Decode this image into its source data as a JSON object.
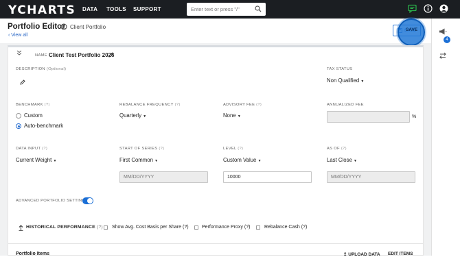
{
  "topbar": {
    "logo": "YCHARTS",
    "nav": [
      "DATA",
      "TOOLS",
      "SUPPORT"
    ],
    "search_placeholder": "Enter text or press \"/\""
  },
  "header": {
    "title": "Portfolio Editor",
    "subtitle": "Client Portfolio",
    "view_all": "View all",
    "save": "SAVE"
  },
  "portfolio": {
    "name_label": "NAME",
    "name": "Client Test Portfolio 2026"
  },
  "fields": {
    "description_label": "DESCRIPTION",
    "description_optional": "(Optional)",
    "tax_status_label": "TAX STATUS",
    "tax_status": "Non Qualified",
    "benchmark_label": "BENCHMARK",
    "benchmark_options": [
      "Custom",
      "Auto-benchmark"
    ],
    "rebalance_label": "REBALANCE FREQUENCY",
    "rebalance": "Quarterly",
    "advisory_label": "ADVISORY FEE",
    "advisory": "None",
    "annualized_label": "ANNUALIZED FEE",
    "annualized_unit": "%",
    "data_input_label": "DATA INPUT",
    "data_input": "Current Weight",
    "start_label": "START OF SERIES",
    "start": "First Common",
    "start_date_placeholder": "MM/DD/YYYY",
    "level_label": "LEVEL",
    "level": "Custom Value",
    "level_value": "10000",
    "as_of_label": "AS OF",
    "as_of": "Last Close",
    "as_of_placeholder": "MM/DD/YYYY",
    "q": "(?)"
  },
  "advanced": {
    "label": "ADVANCED PORTFOLIO SETTINGS",
    "enabled": true
  },
  "bottom": {
    "historical": "HISTORICAL PERFORMANCE",
    "avg_cost": "Show Avg. Cost Basis per Share",
    "perf_proxy": "Performance Proxy",
    "rebalance_cash": "Rebalance Cash",
    "q": "(?)"
  },
  "items": {
    "title": "Portfolio Items",
    "upload": "UPLOAD DATA",
    "edit": "EDIT ITEMS"
  },
  "sidebar": {
    "badge": "4"
  },
  "colors": {
    "topbar": "#1b1e22",
    "accent": "#1b6fd6",
    "green": "#2bb04a"
  }
}
